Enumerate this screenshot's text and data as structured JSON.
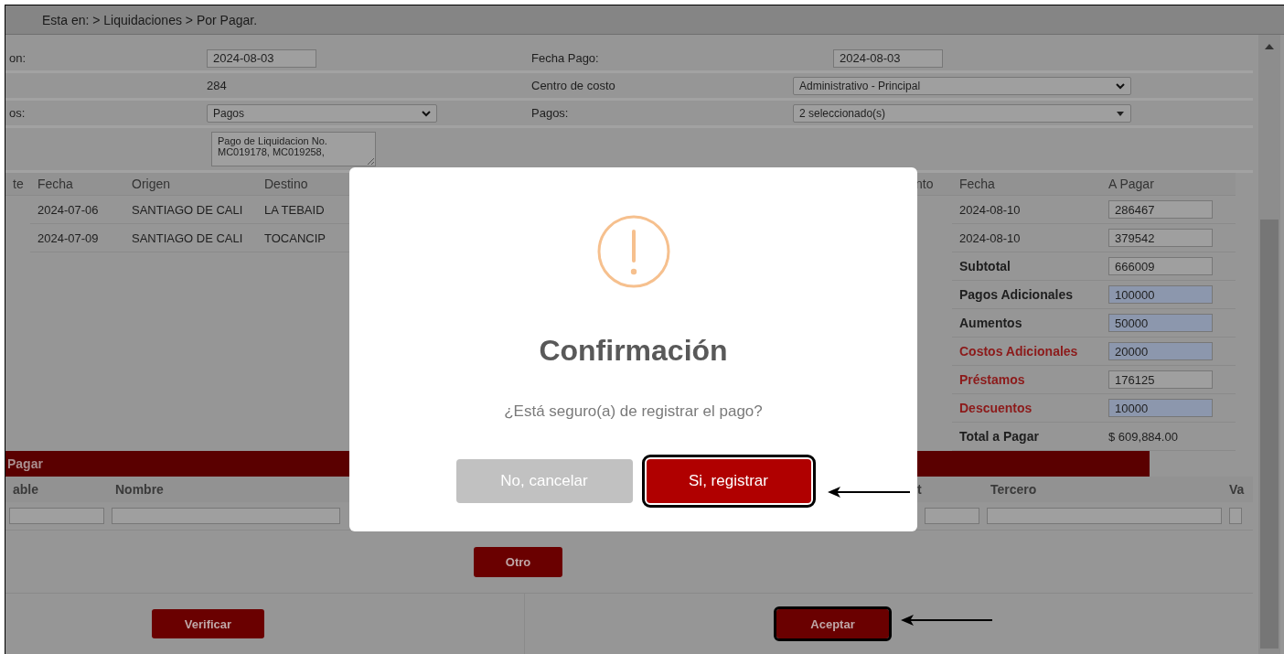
{
  "breadcrumb": "Esta en: > Liquidaciones > Por Pagar.",
  "form_rows": [
    {
      "label": "on:",
      "field": {
        "kind": "input",
        "value": "2024-08-03"
      },
      "label_2": "Fecha Pago:",
      "field_2": {
        "kind": "input",
        "value": "2024-08-03"
      }
    },
    {
      "field": {
        "kind": "text",
        "value": "284"
      },
      "label_2": "Centro de costo",
      "field_2": {
        "kind": "select",
        "value": "Administrativo - Principal"
      }
    },
    {
      "label": "os:",
      "field": {
        "kind": "select",
        "value": "Pagos"
      },
      "label_2": "Pagos:",
      "field_2": {
        "kind": "multiselect",
        "value": "2 seleccionado(s)"
      }
    },
    {
      "field": {
        "kind": "textarea",
        "value": "Pago de Liquidacion No. MC019178, MC019258,"
      }
    }
  ],
  "liquidations": {
    "columns": [
      "te",
      "Fecha",
      "Origen",
      "Destino",
      "nto",
      "Fecha",
      "A Pagar"
    ],
    "rows": [
      {
        "cells": [
          "",
          "2024-07-06",
          "SANTIAGO DE CALI",
          "LA TEBAID",
          "",
          "2024-08-10"
        ],
        "amount": "286467"
      },
      {
        "cells": [
          "",
          "2024-07-09",
          "SANTIAGO DE CALI",
          "TOCANCIP",
          "",
          "2024-08-10"
        ],
        "amount": "379542"
      }
    ]
  },
  "summary": [
    {
      "label": "Subtotal",
      "value": "666009",
      "kind": "subtotal",
      "editable": false
    },
    {
      "label": "Pagos Adicionales",
      "value": "100000",
      "kind": "addition",
      "editable": true
    },
    {
      "label": "Aumentos",
      "value": "50000",
      "kind": "addition",
      "editable": true
    },
    {
      "label": "Costos Adicionales",
      "value": "20000",
      "kind": "deduction",
      "editable": true
    },
    {
      "label": "Préstamos",
      "value": "176125",
      "kind": "deduction",
      "editable": false
    },
    {
      "label": "Descuentos",
      "value": "10000",
      "kind": "deduction",
      "editable": true
    },
    {
      "label": "Total a Pagar",
      "value": "$ 609,884.00",
      "kind": "total"
    }
  ],
  "payments": {
    "title": "Pagar",
    "columns": [
      "able",
      "Nombre",
      "t",
      "Tercero",
      "Va"
    ]
  },
  "add_button": "Otro",
  "footer_buttons": [
    {
      "label": "Verificar",
      "highlighted": false
    },
    {
      "label": "Aceptar",
      "highlighted": true
    }
  ],
  "dialog": {
    "title": "Confirmación",
    "message": "¿Está seguro(a) de registrar el pago?",
    "buttons": [
      {
        "label": "No, cancelar",
        "kind": "cancel",
        "highlighted": false
      },
      {
        "label": "Si, registrar",
        "kind": "confirm",
        "highlighted": true
      }
    ]
  }
}
